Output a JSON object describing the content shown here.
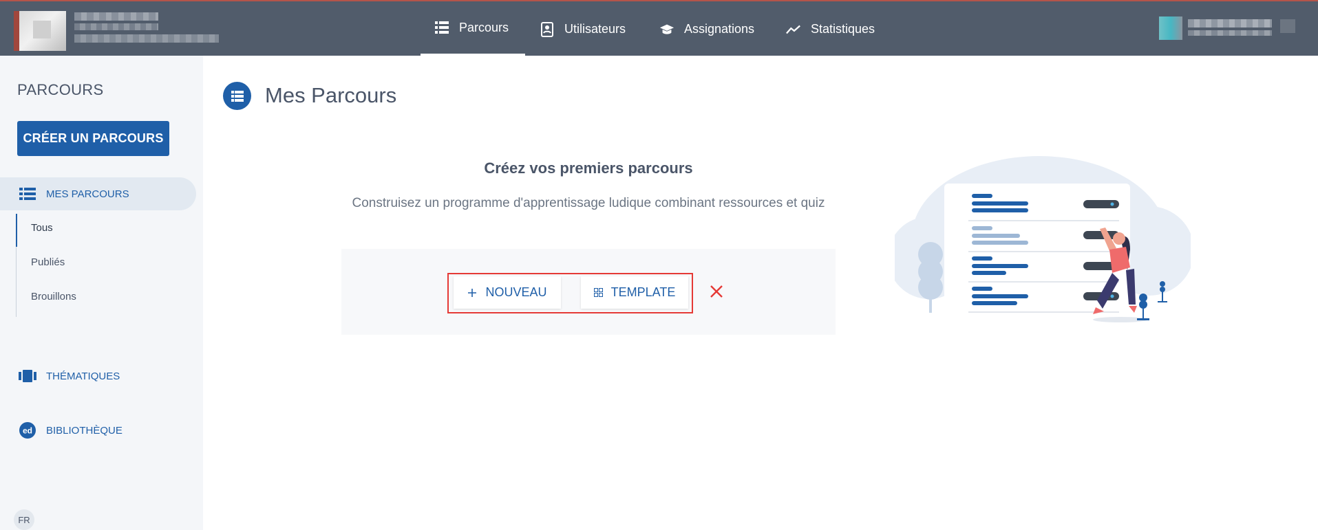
{
  "header": {
    "nav": [
      {
        "label": "Parcours",
        "icon": "list-icon",
        "active": true
      },
      {
        "label": "Utilisateurs",
        "icon": "contact-card-icon",
        "active": false
      },
      {
        "label": "Assignations",
        "icon": "graduation-cap-icon",
        "active": false
      },
      {
        "label": "Statistiques",
        "icon": "trend-line-icon",
        "active": false
      }
    ]
  },
  "sidebar": {
    "title": "PARCOURS",
    "create_button": "CRÉER UN PARCOURS",
    "mes_parcours": "MES PARCOURS",
    "sub_items": [
      "Tous",
      "Publiés",
      "Brouillons"
    ],
    "thematiques": "THÉMATIQUES",
    "bibliotheque": "BIBLIOTHÈQUE",
    "bib_icon_text": "ed",
    "lang": "FR"
  },
  "main": {
    "title": "Mes Parcours",
    "empty_title": "Créez vos premiers parcours",
    "empty_subtitle": "Construisez un programme d'apprentissage ludique combinant ressources et quiz",
    "new_button": "NOUVEAU",
    "template_button": "TEMPLATE"
  },
  "colors": {
    "topbar": "#515c6b",
    "primary": "#1f5fa8",
    "highlight": "#e53935",
    "sidebar_bg": "#f4f6f9"
  }
}
